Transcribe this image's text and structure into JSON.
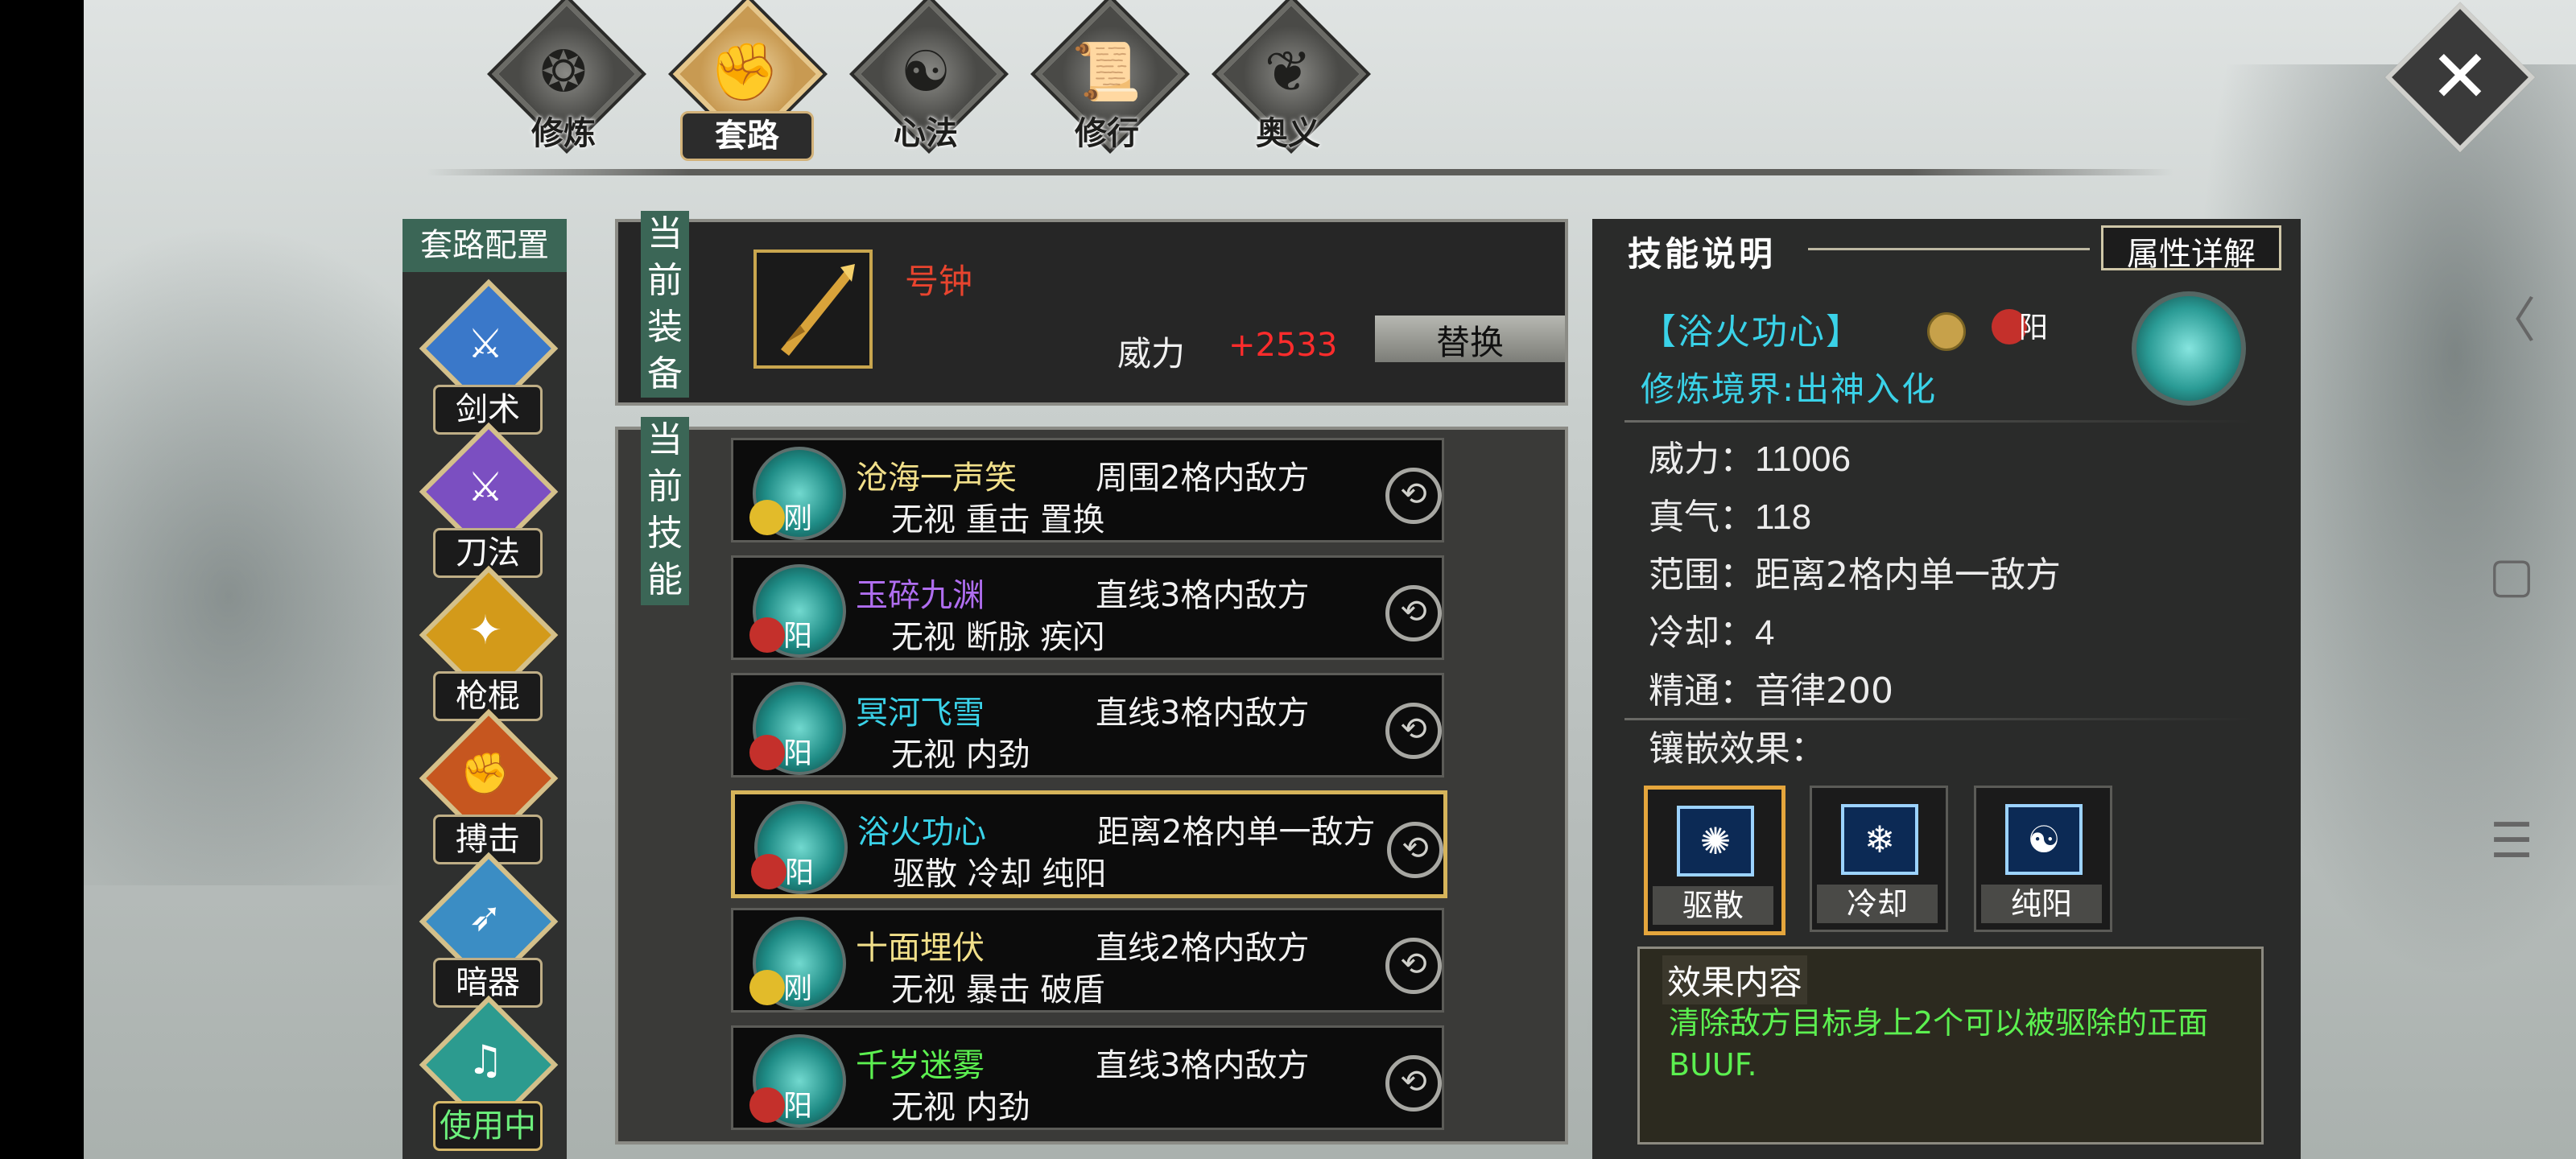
{
  "top_tabs": [
    {
      "label": "修炼",
      "icon": "flame-swirl-icon",
      "glyph": "❂",
      "active": false
    },
    {
      "label": "套路",
      "icon": "fist-icon",
      "glyph": "✊",
      "active": true
    },
    {
      "label": "心法",
      "icon": "yin-yang-swirl-icon",
      "glyph": "☯",
      "active": false
    },
    {
      "label": "修行",
      "icon": "scroll-icon",
      "glyph": "📜",
      "active": false
    },
    {
      "label": "奥义",
      "icon": "lotus-icon",
      "glyph": "❦",
      "active": false
    }
  ],
  "close_icon_glyph": "✕",
  "system_nav": {
    "back": "〈",
    "home": "▢",
    "menu": "☰"
  },
  "left_panel": {
    "title": "套路配置",
    "categories": [
      {
        "label": "剑术",
        "icon": "sword-icon",
        "glyph": "⚔",
        "color": "#3a78c9"
      },
      {
        "label": "刀法",
        "icon": "blade-icon",
        "glyph": "⚔",
        "color": "#7b4fc1"
      },
      {
        "label": "枪棍",
        "icon": "spear-icon",
        "glyph": "✦",
        "color": "#d39a1a"
      },
      {
        "label": "搏击",
        "icon": "fist-icon",
        "glyph": "✊",
        "color": "#c6561f"
      },
      {
        "label": "暗器",
        "icon": "dart-icon",
        "glyph": "➶",
        "color": "#3b8dc4"
      },
      {
        "label": "使用中",
        "icon": "music-icon",
        "glyph": "♫",
        "color": "#2c9b8f",
        "in_use": true
      }
    ]
  },
  "equipment": {
    "vertical_label": "当前装备",
    "name": "号钟",
    "power_label": "威力",
    "power_value": "+2533",
    "replace_label": "替换",
    "icon": "golden-weapon-icon"
  },
  "skills": {
    "vertical_label": "当前技能",
    "list": [
      {
        "name": "沧海一声笑",
        "name_color": "#f2e08a",
        "range": "周围2格内敌方",
        "tags": "无视 重击 置换",
        "badge": "刚",
        "badge_type": "gang"
      },
      {
        "name": "玉碎九渊",
        "name_color": "#b06ef0",
        "range": "直线3格内敌方",
        "tags": "无视 断脉 疾闪",
        "badge": "阳",
        "badge_type": "yang"
      },
      {
        "name": "冥河飞雪",
        "name_color": "#3ad2e8",
        "range": "直线3格内敌方",
        "tags": "无视 内劲",
        "badge": "阳",
        "badge_type": "yang"
      },
      {
        "name": "浴火功心",
        "name_color": "#3ad2e8",
        "range": "距离2格内单一敌方",
        "tags": "驱散 冷却 纯阳",
        "badge": "阳",
        "badge_type": "yang",
        "selected": true
      },
      {
        "name": "十面埋伏",
        "name_color": "#f2e08a",
        "range": "直线2格内敌方",
        "tags": "无视 暴击 破盾",
        "badge": "刚",
        "badge_type": "gang"
      },
      {
        "name": "千岁迷雾",
        "name_color": "#5cf050",
        "range": "直线3格内敌方",
        "tags": "无视 内劲",
        "badge": "阳",
        "badge_type": "yang"
      }
    ]
  },
  "detail": {
    "title": "技能说明",
    "attr_button": "属性详解",
    "skill_name": "【浴火功心】",
    "yang": "阳",
    "realm": "修炼境界:出神入化",
    "stats": [
      {
        "label": "威力：",
        "value": "11006"
      },
      {
        "label": "真气：",
        "value": "118"
      },
      {
        "label": "范围：",
        "value": "距离2格内单一敌方"
      },
      {
        "label": "冷却：",
        "value": "4"
      },
      {
        "label": "精通：",
        "value": "音律200"
      }
    ],
    "inlay_title": "镶嵌效果：",
    "inlays": [
      {
        "label": "驱散",
        "icon": "dispel-icon",
        "glyph": "✺",
        "selected": true
      },
      {
        "label": "冷却",
        "icon": "cooldown-icon",
        "glyph": "❄",
        "selected": false
      },
      {
        "label": "纯阳",
        "icon": "yin-yang-icon",
        "glyph": "☯",
        "selected": false
      }
    ],
    "effect_title": "效果内容",
    "effect_text": "清除敌方目标身上2个可以被驱除的正面BUUF."
  }
}
